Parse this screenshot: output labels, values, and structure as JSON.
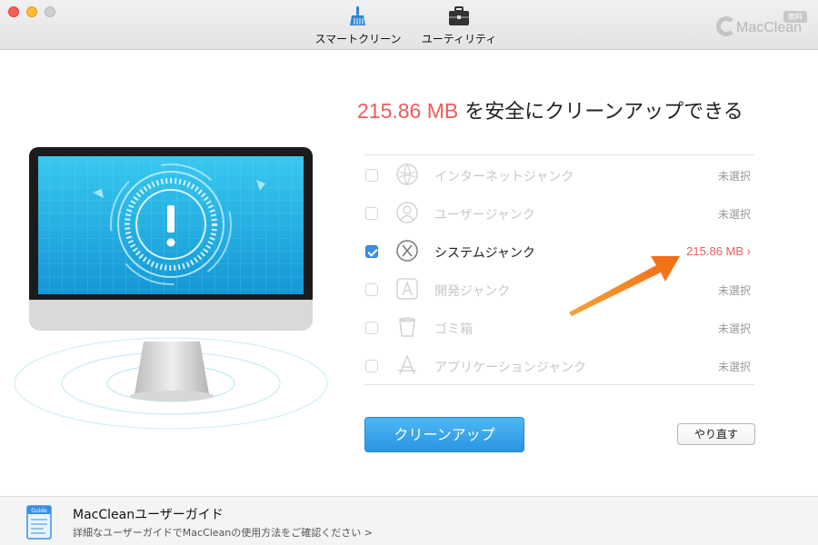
{
  "window": {
    "toolbar": {
      "smart_clean_label": "スマートクリーン",
      "utility_label": "ユーティリティ"
    },
    "brand": {
      "name": "MacClean",
      "badge": "無料"
    }
  },
  "main": {
    "headline": {
      "amount": "215.86 MB",
      "text": " を安全にクリーンアップできる"
    },
    "items": [
      {
        "label": "インターネットジャンク",
        "status": "未選択",
        "checked": false,
        "icon": "globe-icon"
      },
      {
        "label": "ユーザージャンク",
        "status": "未選択",
        "checked": false,
        "icon": "user-icon"
      },
      {
        "label": "システムジャンク",
        "status": "215.86 MB ›",
        "checked": true,
        "icon": "macos-x-icon"
      },
      {
        "label": "開発ジャンク",
        "status": "未選択",
        "checked": false,
        "icon": "xcode-app-icon"
      },
      {
        "label": "ゴミ箱",
        "status": "未選択",
        "checked": false,
        "icon": "trash-icon"
      },
      {
        "label": "アプリケーションジャンク",
        "status": "未選択",
        "checked": false,
        "icon": "app-store-icon"
      }
    ],
    "clean_button": "クリーンアップ",
    "redo_button": "やり直す"
  },
  "footer": {
    "title": "MacCleanユーザーガイド",
    "link": "詳細なユーザーガイドでMacCleanの使用方法をご確認ください >",
    "icon_label": "Guide"
  },
  "colors": {
    "accent_red": "#ee5b5b",
    "button_blue": "#2a95e2",
    "arrow_orange": "#f47a20"
  }
}
